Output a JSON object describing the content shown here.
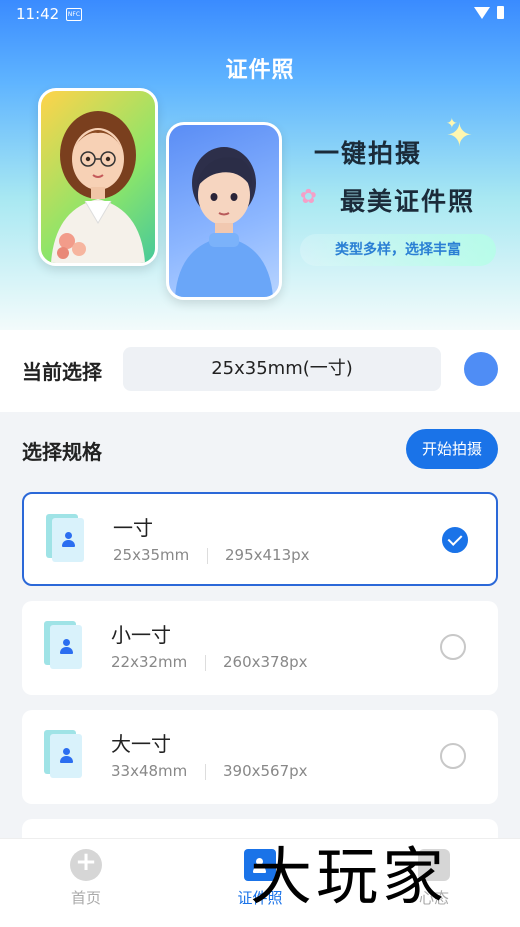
{
  "status_bar": {
    "time": "11:42",
    "nfc_label": "NFC"
  },
  "header": {
    "title": "证件照"
  },
  "banner": {
    "slogan_line1": "一键拍摄",
    "slogan_line2": "最美证件照",
    "tagline": "类型多样，选择丰富"
  },
  "current_selection": {
    "label": "当前选择",
    "value": "25x35mm(一寸)"
  },
  "spec_section": {
    "title": "选择规格",
    "start_button": "开始拍摄"
  },
  "specs": [
    {
      "name": "一寸",
      "mm": "25x35mm",
      "px": "295x413px",
      "selected": true
    },
    {
      "name": "小一寸",
      "mm": "22x32mm",
      "px": "260x378px",
      "selected": false
    },
    {
      "name": "大一寸",
      "mm": "33x48mm",
      "px": "390x567px",
      "selected": false
    }
  ],
  "tabbar": {
    "home": "首页",
    "id_photo": "证件照",
    "mine": "心态",
    "active": "证件照"
  },
  "watermark": "大玩家",
  "colors": {
    "accent": "#1a73e8",
    "selected_border": "#2b68d8"
  }
}
